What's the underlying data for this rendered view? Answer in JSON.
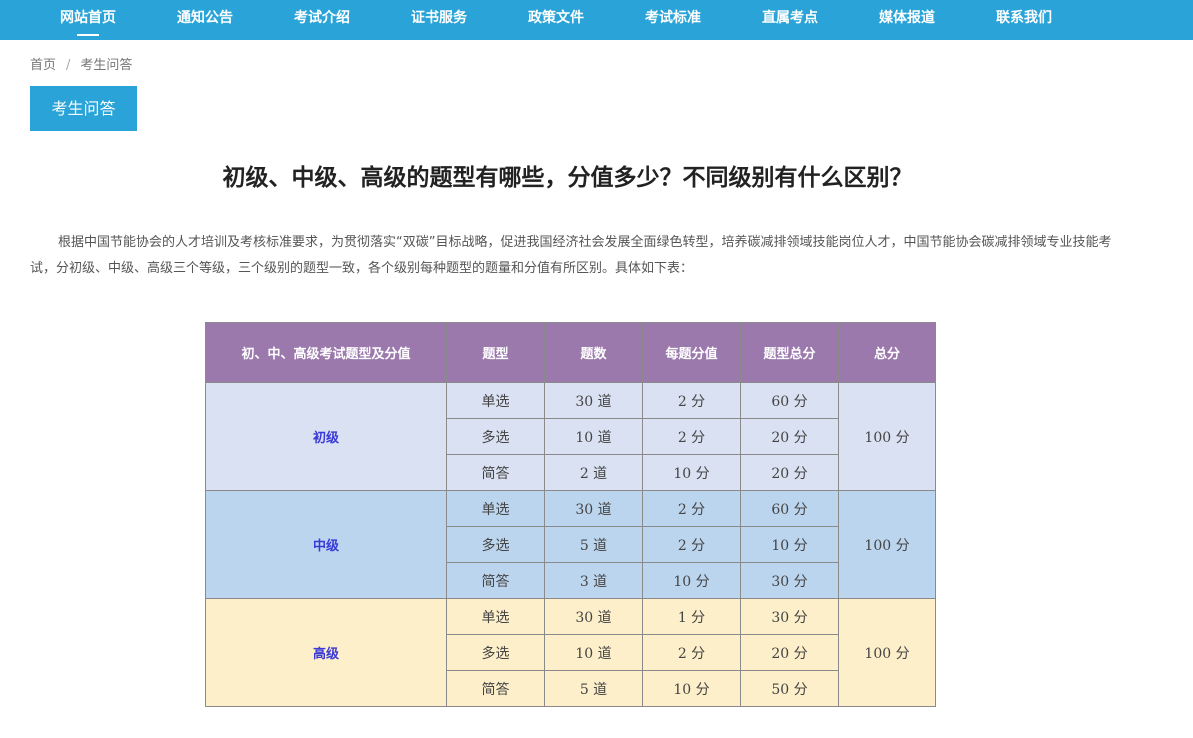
{
  "nav": {
    "items": [
      {
        "label": "网站首页"
      },
      {
        "label": "通知公告"
      },
      {
        "label": "考试介绍"
      },
      {
        "label": "证书服务"
      },
      {
        "label": "政策文件"
      },
      {
        "label": "考试标准"
      },
      {
        "label": "直属考点"
      },
      {
        "label": "媒体报道"
      },
      {
        "label": "联系我们"
      }
    ]
  },
  "breadcrumb": {
    "home": "首页",
    "separator": "/",
    "current": "考生问答"
  },
  "section_tab": "考生问答",
  "article": {
    "title": "初级、中级、高级的题型有哪些，分值多少？不同级别有什么区别？",
    "intro": "根据中国节能协会的人才培训及考核标准要求，为贯彻落实“双碳”目标战略，促进我国经济社会发展全面绿色转型，培养碳减排领域技能岗位人才，中国节能协会碳减排领域专业技能考试，分初级、中级、高级三个等级，三个级别的题型一致，各个级别每种题型的题量和分值有所区别。具体如下表："
  },
  "table": {
    "headers": [
      "初、中、高级考试题型及分值",
      "题型",
      "题数",
      "每题分值",
      "题型总分",
      "总分"
    ],
    "groups": [
      {
        "level": "初级",
        "total": "100 分",
        "rows": [
          [
            "单选",
            "30 道",
            "2 分",
            "60 分"
          ],
          [
            "多选",
            "10 道",
            "2 分",
            "20 分"
          ],
          [
            "简答",
            "2 道",
            "10 分",
            "20 分"
          ]
        ]
      },
      {
        "level": "中级",
        "total": "100 分",
        "rows": [
          [
            "单选",
            "30 道",
            "2 分",
            "60 分"
          ],
          [
            "多选",
            "5 道",
            "2 分",
            "10 分"
          ],
          [
            "简答",
            "3 道",
            "10 分",
            "30 分"
          ]
        ]
      },
      {
        "level": "高级",
        "total": "100 分",
        "rows": [
          [
            "单选",
            "30 道",
            "1 分",
            "30 分"
          ],
          [
            "多选",
            "10 道",
            "2 分",
            "20 分"
          ],
          [
            "简答",
            "5 道",
            "10 分",
            "50 分"
          ]
        ]
      }
    ]
  },
  "colors": {
    "nav_bg": "#2aa4d8",
    "header_bg": "#9b79ad",
    "junior_bg": "#d9e1f2",
    "mid_bg": "#bcd5ee",
    "senior_bg": "#fdefc9",
    "level_text": "#3a3ad6"
  }
}
